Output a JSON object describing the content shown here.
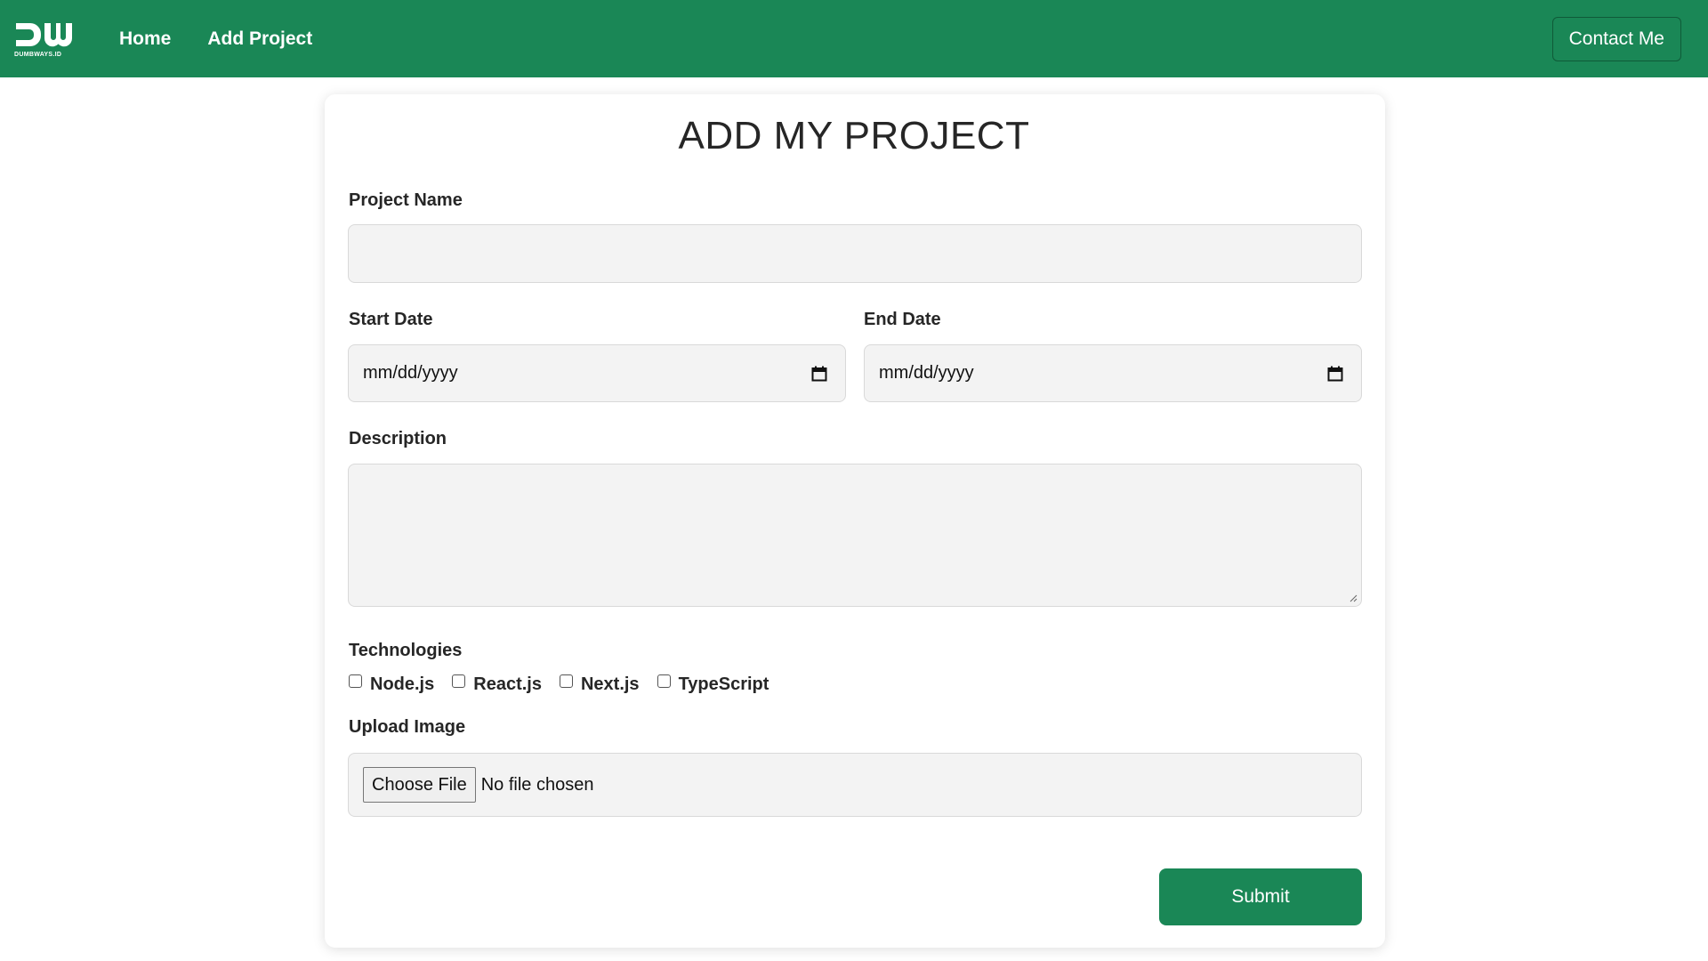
{
  "navbar": {
    "logo_text": "DW",
    "logo_subtext": "DUMBWAYS.ID",
    "links": [
      "Home",
      "Add Project"
    ],
    "contact_label": "Contact Me"
  },
  "form": {
    "title": "ADD MY PROJECT",
    "project_name_label": "Project Name",
    "project_name_value": "",
    "start_date_label": "Start Date",
    "start_date_placeholder": "mm/dd/yyyy",
    "end_date_label": "End Date",
    "end_date_placeholder": "mm/dd/yyyy",
    "description_label": "Description",
    "description_value": "",
    "technologies_label": "Technologies",
    "technologies": [
      {
        "label": "Node.js",
        "checked": false
      },
      {
        "label": "React.js",
        "checked": false
      },
      {
        "label": "Next.js",
        "checked": false
      },
      {
        "label": "TypeScript",
        "checked": false
      }
    ],
    "upload_label": "Upload Image",
    "choose_file_label": "Choose File",
    "no_file_text": "No file chosen",
    "submit_label": "Submit"
  },
  "colors": {
    "brand_green": "#1a8756",
    "input_bg": "#f3f3f3"
  },
  "icons": [
    "calendar-icon",
    "resize-grip-icon"
  ]
}
